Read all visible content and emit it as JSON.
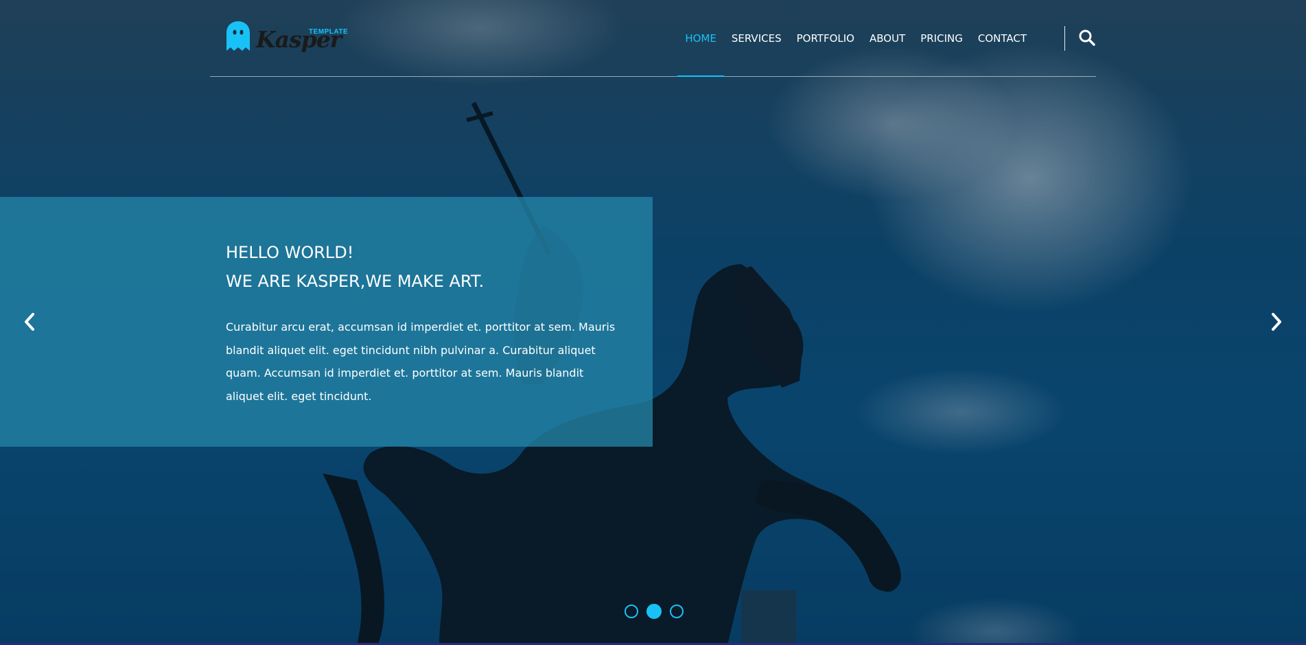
{
  "brand": {
    "name": "Kasper",
    "tagline": "TEMPLATE",
    "accent_color": "#19c2f6"
  },
  "nav": {
    "items": [
      {
        "label": "HOME",
        "active": true
      },
      {
        "label": "SERVICES",
        "active": false
      },
      {
        "label": "PORTFOLIO",
        "active": false
      },
      {
        "label": "ABOUT",
        "active": false
      },
      {
        "label": "PRICING",
        "active": false
      },
      {
        "label": "CONTACT",
        "active": false
      }
    ],
    "search_icon": "search-icon"
  },
  "slider": {
    "title_line1": "HELLO WORLD!",
    "title_line2": "WE ARE KASPER,WE MAKE ART.",
    "text": "Curabitur arcu erat, accumsan id imperdiet et. porttitor at sem. Mauris blandit aliquet elit. eget tincidunt nibh pulvinar a. Curabitur aliquet quam. Accumsan id imperdiet et. porttitor at sem. Mauris blandit aliquet elit. eget tincidunt.",
    "prev_icon": "chevron-left-icon",
    "next_icon": "chevron-right-icon",
    "bullets": [
      {
        "active": false
      },
      {
        "active": true
      },
      {
        "active": false
      }
    ]
  }
}
